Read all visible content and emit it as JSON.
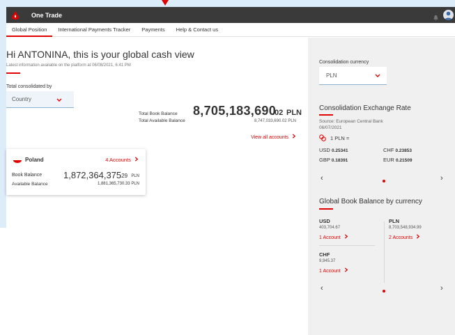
{
  "app": {
    "title": "One Trade"
  },
  "nav": {
    "items": [
      {
        "label": "Global Position",
        "active": true
      },
      {
        "label": "International Payments Tracker",
        "active": false
      },
      {
        "label": "Payments",
        "active": false
      },
      {
        "label": "Help & Contact us",
        "active": false
      }
    ]
  },
  "main": {
    "greeting": "Hi ANTONINA, this is your global cash view",
    "latest_info": "Latest information available on the platform at  06/08/2021, 6:41 PM",
    "total_by_label": "Total consolidated by",
    "total_by_value": "Country",
    "total_book_label": "Total Book Balance",
    "total_book_int": "8,705,183,690",
    "total_book_dec": ".02",
    "total_book_currency": "PLN",
    "total_available_label": "Total Available Balance",
    "total_available_value": "8,747,033,690.02  PLN",
    "view_all": "View all accounts",
    "country_card": {
      "country": "Poland",
      "accounts": "4 Accounts",
      "book_label": "Book Balance",
      "book_int": "1,872,364,375",
      "book_dec": ".29",
      "book_currency": "PLN",
      "available_label": "Available Balance",
      "available_value": "1,881,365,730.33  PLN"
    }
  },
  "right": {
    "consolidation_label": "Consolidation currency",
    "consolidation_value": "PLN",
    "rate_title": "Consolidation Exchange Rate",
    "rate_source": "Source: European Central Bank",
    "rate_date": "06/07/2021",
    "rate_base": "1 PLN =",
    "rates": [
      {
        "cur": "USD",
        "val": "0.25341"
      },
      {
        "cur": "CHF",
        "val": "0.23853"
      },
      {
        "cur": "GBP",
        "val": "0.18391"
      },
      {
        "cur": "EUR",
        "val": "0.21509"
      }
    ],
    "gbb_title": "Global Book Balance by currency",
    "currencies": [
      {
        "cur": "USD",
        "val": "403,704.67",
        "link": "1 Account"
      },
      {
        "cur": "PLN",
        "val": "8,703,548,934.99",
        "link": "2 Accounts"
      },
      {
        "cur": "CHF",
        "val": "9,945.37",
        "link": "1 Account"
      }
    ],
    "prev_glyph": "‹",
    "next_glyph": "›"
  },
  "colors": {
    "accent": "#e00000",
    "topbar": "#3a3a3a",
    "panel": "#f0f0f0"
  }
}
